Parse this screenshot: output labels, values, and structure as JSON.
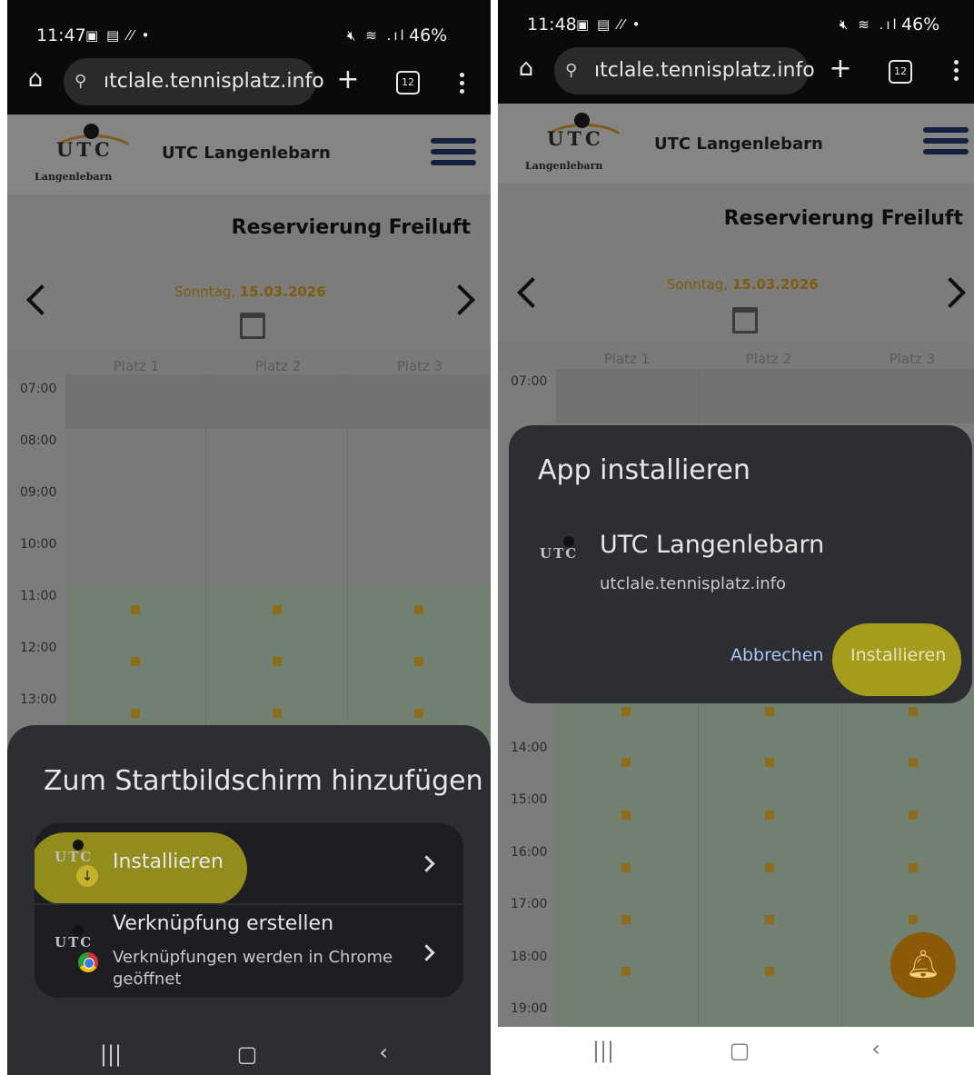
{
  "left": {
    "status": {
      "time": "11:47",
      "battery": "46%"
    },
    "url": "utclale.tennisplatz.info",
    "url_display": "ıtclale.tennisplatz.info",
    "tab_count": "12",
    "site": {
      "logo_text": "UTC",
      "logo_sub": "Langenlebarn",
      "name": "UTC Langenlebarn",
      "page_title": "Reservierung Freiluft"
    },
    "date": {
      "weekday": "Sonntag, ",
      "date": "15.03.2026"
    },
    "courts": [
      "Platz 1",
      "Platz 2",
      "Platz 3"
    ],
    "times": [
      "07:00",
      "08:00",
      "09:00",
      "10:00",
      "11:00",
      "12:00",
      "13:00"
    ],
    "sheet": {
      "title": "Zum Startbildschirm hinzufügen",
      "option1_label": "Installieren",
      "option2_label": "Verknüpfung erstellen",
      "option2_sub": "Verknüpfungen werden in Chrome geöffnet"
    }
  },
  "right": {
    "status": {
      "time": "11:48",
      "battery": "46%"
    },
    "url": "utclale.tennisplatz.info",
    "url_display": "ıtclale.tennisplatz.info",
    "tab_count": "12",
    "site": {
      "logo_text": "UTC",
      "logo_sub": "Langenlebarn",
      "name": "UTC Langenlebarn",
      "page_title": "Reservierung Freiluft"
    },
    "date": {
      "weekday": "Sonntag, ",
      "date": "15.03.2026"
    },
    "courts": [
      "Platz 1",
      "Platz 2",
      "Platz 3"
    ],
    "times": [
      "07:00",
      "14:00",
      "15:00",
      "16:00",
      "17:00",
      "18:00",
      "19:00"
    ],
    "dialog": {
      "title": "App installieren",
      "app_name": "UTC Langenlebarn",
      "app_url": "utclale.tennisplatz.info",
      "cancel_label": "Abbrechen",
      "install_label": "Installieren"
    }
  },
  "colors": {
    "highlight": "#a39c1c",
    "date": "#7d5c10",
    "cancel": "#a9c3f4"
  }
}
